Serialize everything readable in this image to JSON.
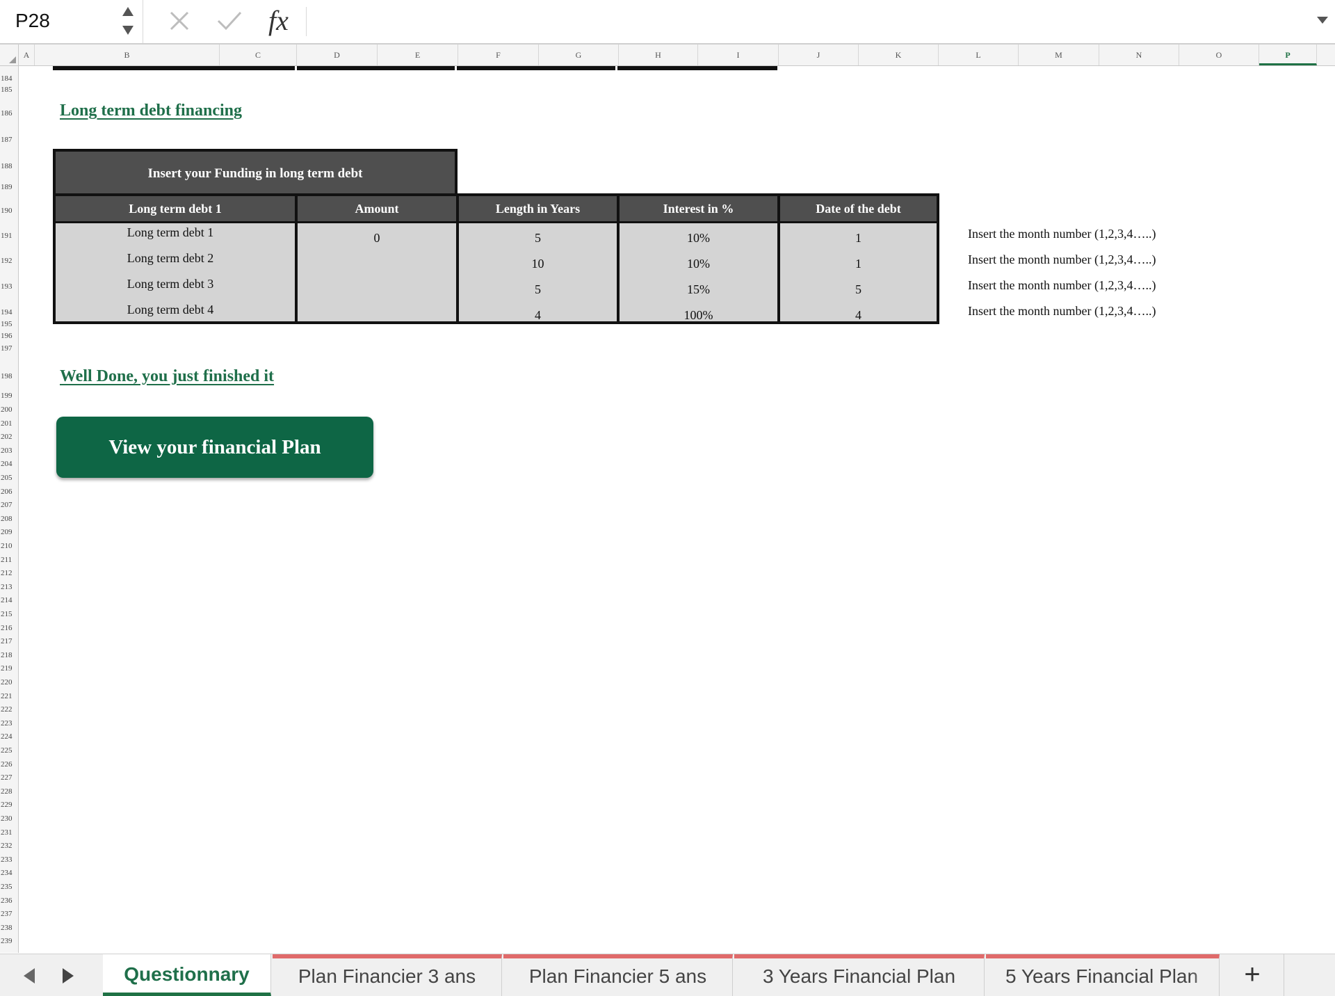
{
  "formula_bar": {
    "name_box": "P28",
    "formula": ""
  },
  "columns": [
    "A",
    "B",
    "C",
    "D",
    "E",
    "F",
    "G",
    "H",
    "I",
    "J",
    "K",
    "L",
    "M",
    "N",
    "O",
    "P"
  ],
  "active_column": "P",
  "rows": [
    "184",
    "185",
    "186",
    "187",
    "188",
    "189",
    "190",
    "191",
    "192",
    "193",
    "194",
    "195",
    "196",
    "197",
    "198",
    "199",
    "200",
    "201",
    "202",
    "203",
    "204",
    "205",
    "206",
    "207",
    "208",
    "209",
    "210",
    "211",
    "212",
    "213",
    "214",
    "215",
    "216",
    "217",
    "218",
    "219",
    "220",
    "221",
    "222",
    "223",
    "224",
    "225",
    "226",
    "227",
    "228",
    "229",
    "230",
    "231",
    "232",
    "233",
    "234",
    "235",
    "236",
    "237",
    "238",
    "239"
  ],
  "sheet": {
    "section_title": "Long term debt financing",
    "banner": "Insert your Funding in long term debt",
    "table": {
      "headers": [
        "Long term debt 1",
        "Amount",
        "Length in Years",
        "Interest in %",
        "Date of the debt"
      ],
      "rows": [
        {
          "name": "Long term debt 1",
          "amount": "0",
          "length": "5",
          "interest": "10%",
          "date": "1"
        },
        {
          "name": "Long term debt 2",
          "amount": "",
          "length": "10",
          "interest": "10%",
          "date": "1"
        },
        {
          "name": "Long term debt 3",
          "amount": "",
          "length": "5",
          "interest": "15%",
          "date": "5"
        },
        {
          "name": "Long term debt 4",
          "amount": "",
          "length": "4",
          "interest": "100%",
          "date": "4"
        }
      ],
      "notes": [
        "Insert the month number (1,2,3,4…..)",
        "Insert the month number (1,2,3,4…..)",
        "Insert the month number (1,2,3,4…..)",
        "Insert the month number (1,2,3,4…..)"
      ]
    },
    "done_title": "Well Done, you just finished it",
    "view_plan_label": "View your financial Plan"
  },
  "tabs": [
    {
      "label": "Questionnary",
      "active": true
    },
    {
      "label": "Plan Financier 3 ans"
    },
    {
      "label": "Plan Financier 5 ans"
    },
    {
      "label": "3 Years Financial Plan"
    },
    {
      "label": "5 Years Financial Plan"
    }
  ],
  "icons": {
    "stepper": "stepper-icon",
    "cancel": "cancel-icon",
    "confirm": "check-icon",
    "function": "fx-icon",
    "expand": "chevron-down-icon",
    "prev": "chevron-left-icon",
    "next": "chevron-right-icon",
    "add": "plus-icon"
  },
  "colors": {
    "accent": "#1f6f4a",
    "button": "#0e6645",
    "header_dark": "#4f4f4f",
    "table_fill": "#d4d4d4",
    "tab_marker": "#e06b6b"
  }
}
